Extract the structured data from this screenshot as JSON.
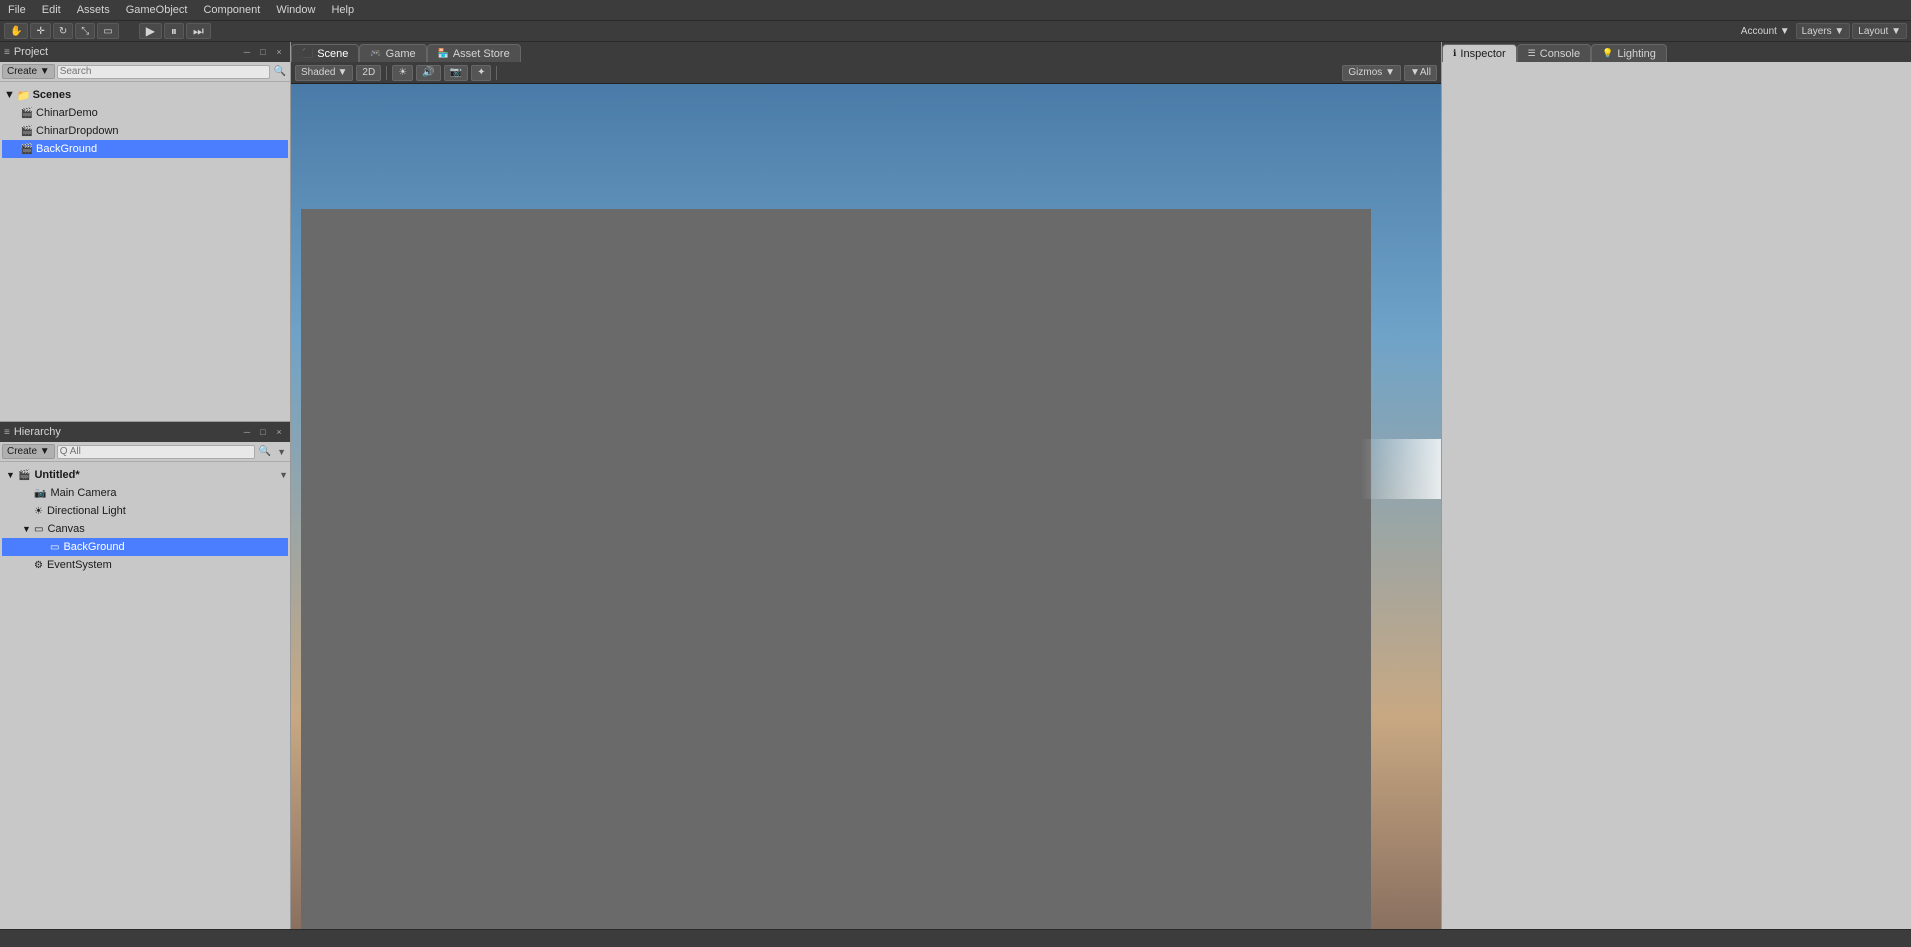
{
  "topMenu": {
    "items": [
      "File",
      "Edit",
      "Assets",
      "GameObject",
      "Component",
      "Window",
      "Help"
    ]
  },
  "toolbar": {
    "playBtn": "▶",
    "pauseBtn": "⏸",
    "stepBtn": "⏭",
    "layers": "Layers",
    "account": "Account ▼",
    "layout": "Layout ▼"
  },
  "projectPanel": {
    "title": "Project",
    "createBtn": "Create",
    "searchPlaceholder": "Search",
    "scenes": {
      "label": "Scenes",
      "items": [
        "ChinarDemo",
        "ChinarDropdown",
        "BackGround"
      ]
    }
  },
  "hierarchyPanel": {
    "title": "Hierarchy",
    "createBtn": "Create",
    "searchPlaceholder": "Q All",
    "scene": {
      "name": "Untitled*",
      "items": [
        {
          "label": "Main Camera",
          "indent": 1,
          "hasArrow": false
        },
        {
          "label": "Directional Light",
          "indent": 1,
          "hasArrow": false
        },
        {
          "label": "Canvas",
          "indent": 1,
          "hasArrow": true,
          "expanded": true
        },
        {
          "label": "BackGround",
          "indent": 2,
          "hasArrow": false,
          "selected": true
        },
        {
          "label": "EventSystem",
          "indent": 1,
          "hasArrow": false
        }
      ]
    }
  },
  "sceneView": {
    "tabs": [
      {
        "label": "Scene",
        "active": true,
        "icon": "⬛"
      },
      {
        "label": "Game",
        "active": false,
        "icon": "🎮"
      },
      {
        "label": "Asset Store",
        "active": false,
        "icon": "🏪"
      }
    ],
    "toolbar": {
      "shading": "Shaded",
      "mode2D": "2D",
      "icons": [
        "☀",
        "🔊",
        "📷"
      ],
      "gizmos": "Gizmos ▼",
      "layers": "▼All"
    }
  },
  "inspectorPanel": {
    "tabs": [
      {
        "label": "Inspector",
        "active": true,
        "icon": "ℹ"
      },
      {
        "label": "Console",
        "active": false,
        "icon": "☰"
      },
      {
        "label": "Lighting",
        "active": false,
        "icon": "💡"
      }
    ]
  },
  "icons": {
    "hierarchy": "≡",
    "project": "📁",
    "scene": "⬛",
    "inspector": "ℹ",
    "console": "☰",
    "lighting": "💡",
    "collapse": "─",
    "expand": "□",
    "close": "×",
    "arrow_right": "▶",
    "arrow_down": "▼",
    "camera": "📷",
    "gameObject": "🎮"
  },
  "colors": {
    "panelBg": "#c8c8c8",
    "headerBg": "#3c3c3c",
    "selected": "#4a7eff",
    "border": "#999999",
    "text": "#1a1a1a",
    "textLight": "#d4d4d4"
  }
}
